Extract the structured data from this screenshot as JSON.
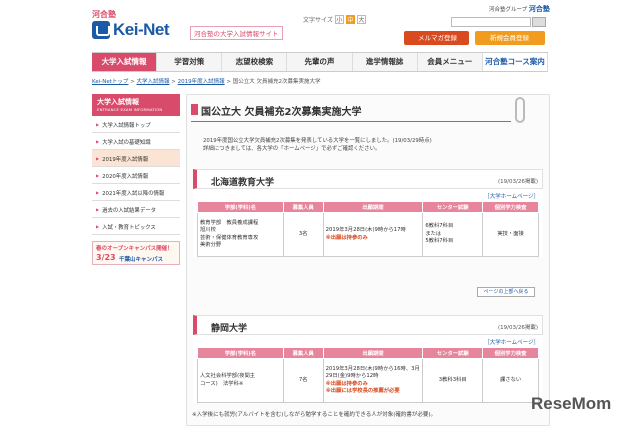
{
  "header": {
    "logo_small": "河合塾",
    "logo_text": "Kei-Net",
    "logo_sub": "河合塾の大学入試情報サイト",
    "font_size_label": "文字サイズ",
    "font_sizes": [
      "小",
      "中",
      "大"
    ],
    "group_label": "河合塾グループ",
    "group_brand": "河合塾",
    "mail_button": "メルマガ登録",
    "register_button": "新規会員登録"
  },
  "nav": [
    "大学入試情報",
    "学習対策",
    "志望校検索",
    "先輩の声",
    "進学情報誌",
    "会員メニュー",
    "河合塾コース案内"
  ],
  "breadcrumb": {
    "l1": "Kei-Netトップ",
    "l2": "大学入試情報",
    "l3": "2019年度入試情報",
    "current": "国公立大 欠員補充2次募集実施大学"
  },
  "sidebar": {
    "title": "大学入試情報",
    "subtitle": "ENTRANCE EXAM INFORMATION",
    "items": [
      "大学入試情報トップ",
      "大学入試の基礎知識",
      "2019年度入試情報",
      "2020年度入試情報",
      "2021年度入試以降の情報",
      "過去の入試結果データ",
      "入試・教育トピックス"
    ],
    "banner_l1": "春のオープンキャンパス開催！",
    "banner_l2": "3/23",
    "banner_l3": "千葉山キャンパス"
  },
  "main": {
    "title": "国公立大 欠員補充2次募集実施大学",
    "intro1": "2019年度国公立大学欠員補充2次募集を発表している大学を一覧にしました。(19/03/29時点)",
    "intro2": "詳細につきましては、各大学の「ホームページ」で必ずご確認ください。",
    "page_top": "ページの上部へ戻る",
    "note": "※入学後にも就労(アルバイトを含む)しながら勉学することを確約できる人が対象(確約書が必要)。"
  },
  "table_headers": [
    "学部(学科)名",
    "募集人員",
    "出願期間",
    "センター試験",
    "個別学力検査"
  ],
  "universities": [
    {
      "name": "北海道教育大学",
      "date": "(19/03/26掲載)",
      "hp": "［大学ホームページ］",
      "faculty": [
        "教育学部　教員養成課程",
        "旭川校",
        "芸術・保健体育教育専攻",
        "美術分野"
      ],
      "quota": "3名",
      "period": "2019年3月28日(木)9時から17時",
      "period_note": "※出願は持参のみ",
      "center": [
        "6教科7科目",
        "または",
        "5教科7科目"
      ],
      "exam": "実技・面接"
    },
    {
      "name": "静岡大学",
      "date": "(19/03/26掲載)",
      "hp": "［大学ホームページ］",
      "faculty": [
        "人文社会科学部(夜間主",
        "コース)　法学科※"
      ],
      "quota": "7名",
      "period": "2019年3月28日(木)9時から16時、3月29日(金)9時から12時",
      "period_note": "※出願は持参のみ",
      "period_note2": "※出願には学校長の推薦が必要",
      "center": [
        "3教科3科目"
      ],
      "exam": "課さない"
    }
  ],
  "watermark": "ReseMom"
}
